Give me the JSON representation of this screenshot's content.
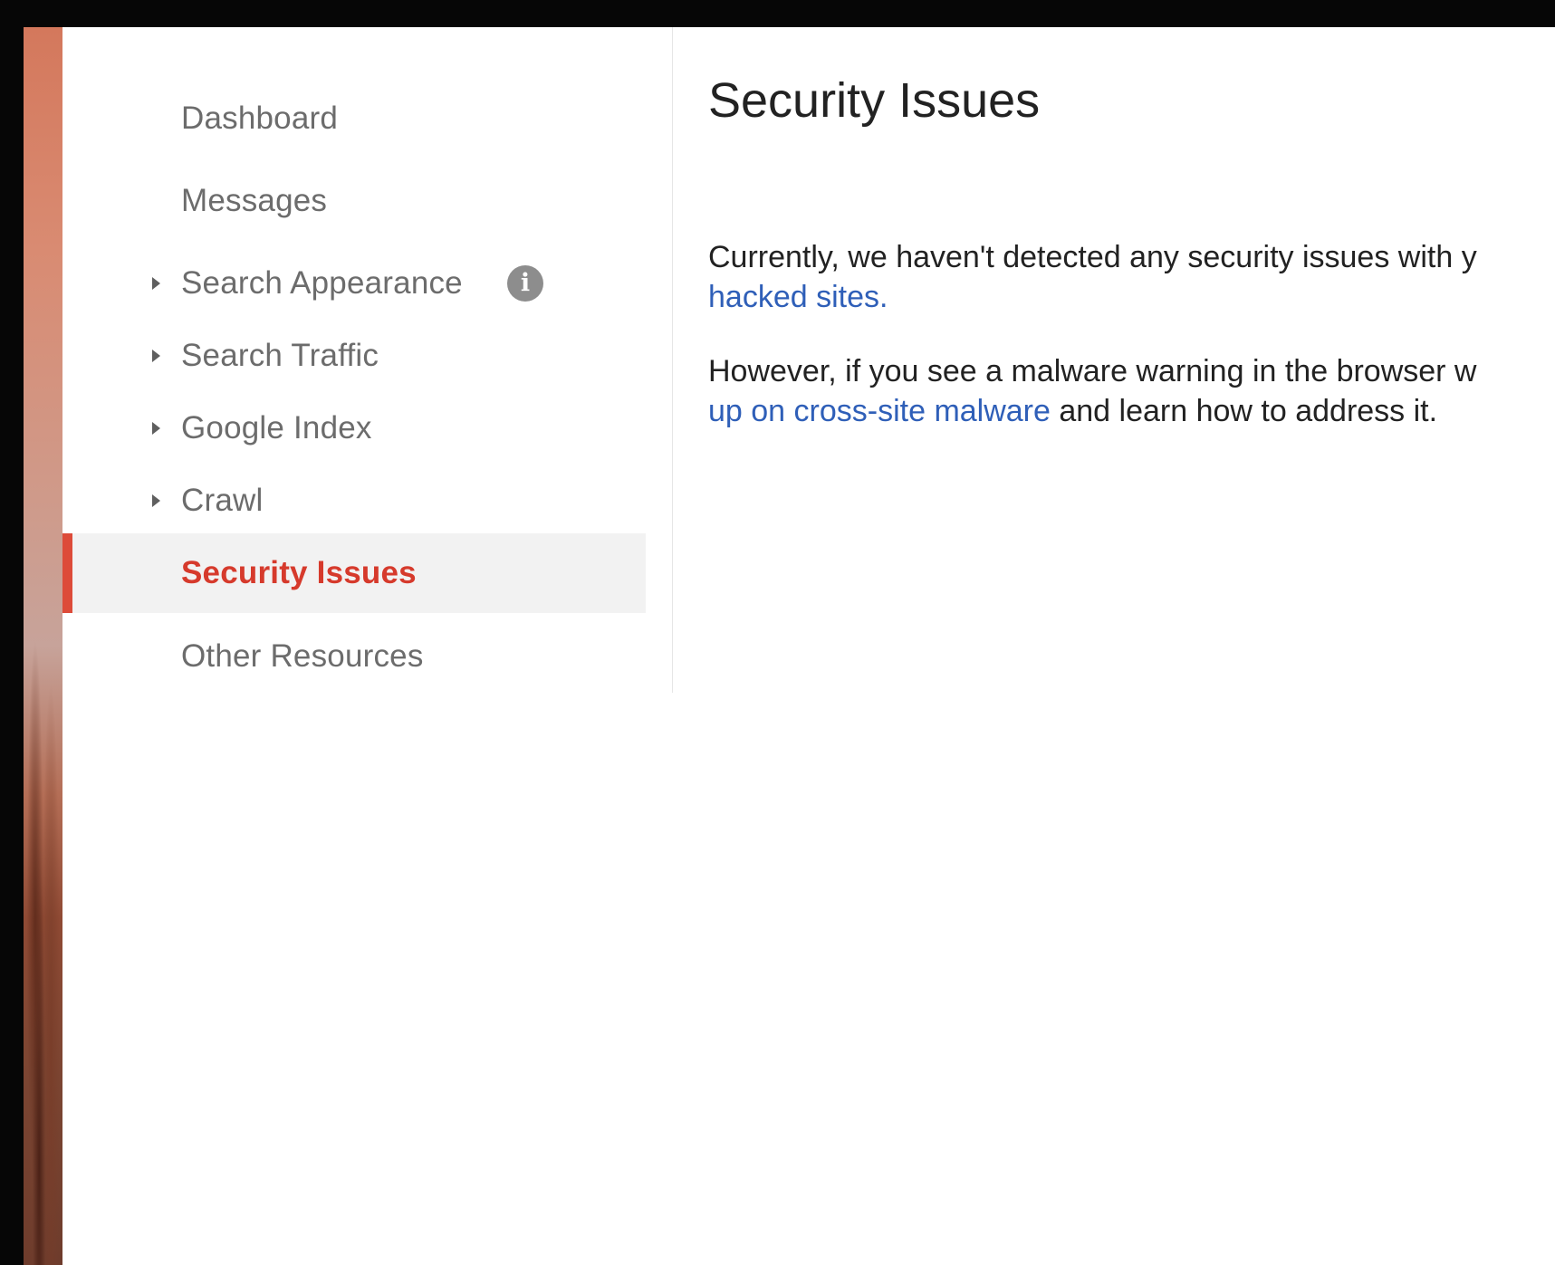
{
  "sidebar": {
    "items": [
      {
        "label": "Dashboard",
        "expandable": false,
        "active": false
      },
      {
        "label": "Messages",
        "expandable": false,
        "active": false
      },
      {
        "label": "Search Appearance",
        "expandable": true,
        "active": false,
        "info_icon": "info-icon"
      },
      {
        "label": "Search Traffic",
        "expandable": true,
        "active": false
      },
      {
        "label": "Google Index",
        "expandable": true,
        "active": false
      },
      {
        "label": "Crawl",
        "expandable": true,
        "active": false
      },
      {
        "label": "Security Issues",
        "expandable": false,
        "active": true
      },
      {
        "label": "Other Resources",
        "expandable": false,
        "active": false
      }
    ]
  },
  "main": {
    "title": "Security Issues",
    "paragraph1": {
      "text": "Currently, we haven't detected any security issues with y",
      "link": "hacked sites."
    },
    "paragraph2": {
      "text": "However, if you see a malware warning in the browser w",
      "link": "up on cross-site malware",
      "text_after": " and learn how to address it."
    }
  },
  "colors": {
    "accent": "#dd4b39",
    "active_text": "#d63a2c",
    "link": "#2f5fb8",
    "active_bg": "#f2f2f2",
    "nav_text": "#6c6c6c"
  },
  "icons": {
    "expand_arrow": "triangle-right-icon",
    "info": "info-icon"
  }
}
